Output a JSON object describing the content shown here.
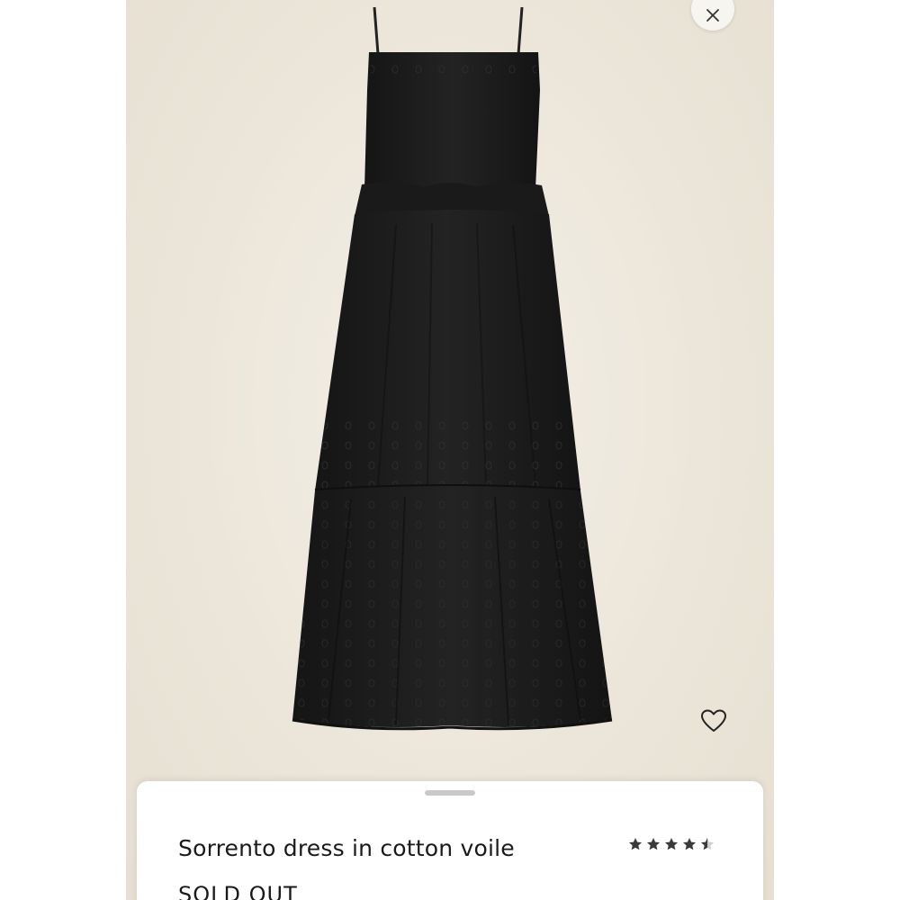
{
  "product": {
    "name": "Sorrento dress in cotton voile",
    "status": "SOLD OUT",
    "rating": 4.5,
    "rating_max": 5
  },
  "icons": {
    "close": "close-icon",
    "favorite": "heart-outline-icon",
    "star": "star-icon",
    "handle": "drag-handle"
  },
  "colors": {
    "image_background": "#ece6da",
    "dress": "#1c1c1c",
    "text": "#1a1a1a",
    "star": "#3a3a3a"
  }
}
